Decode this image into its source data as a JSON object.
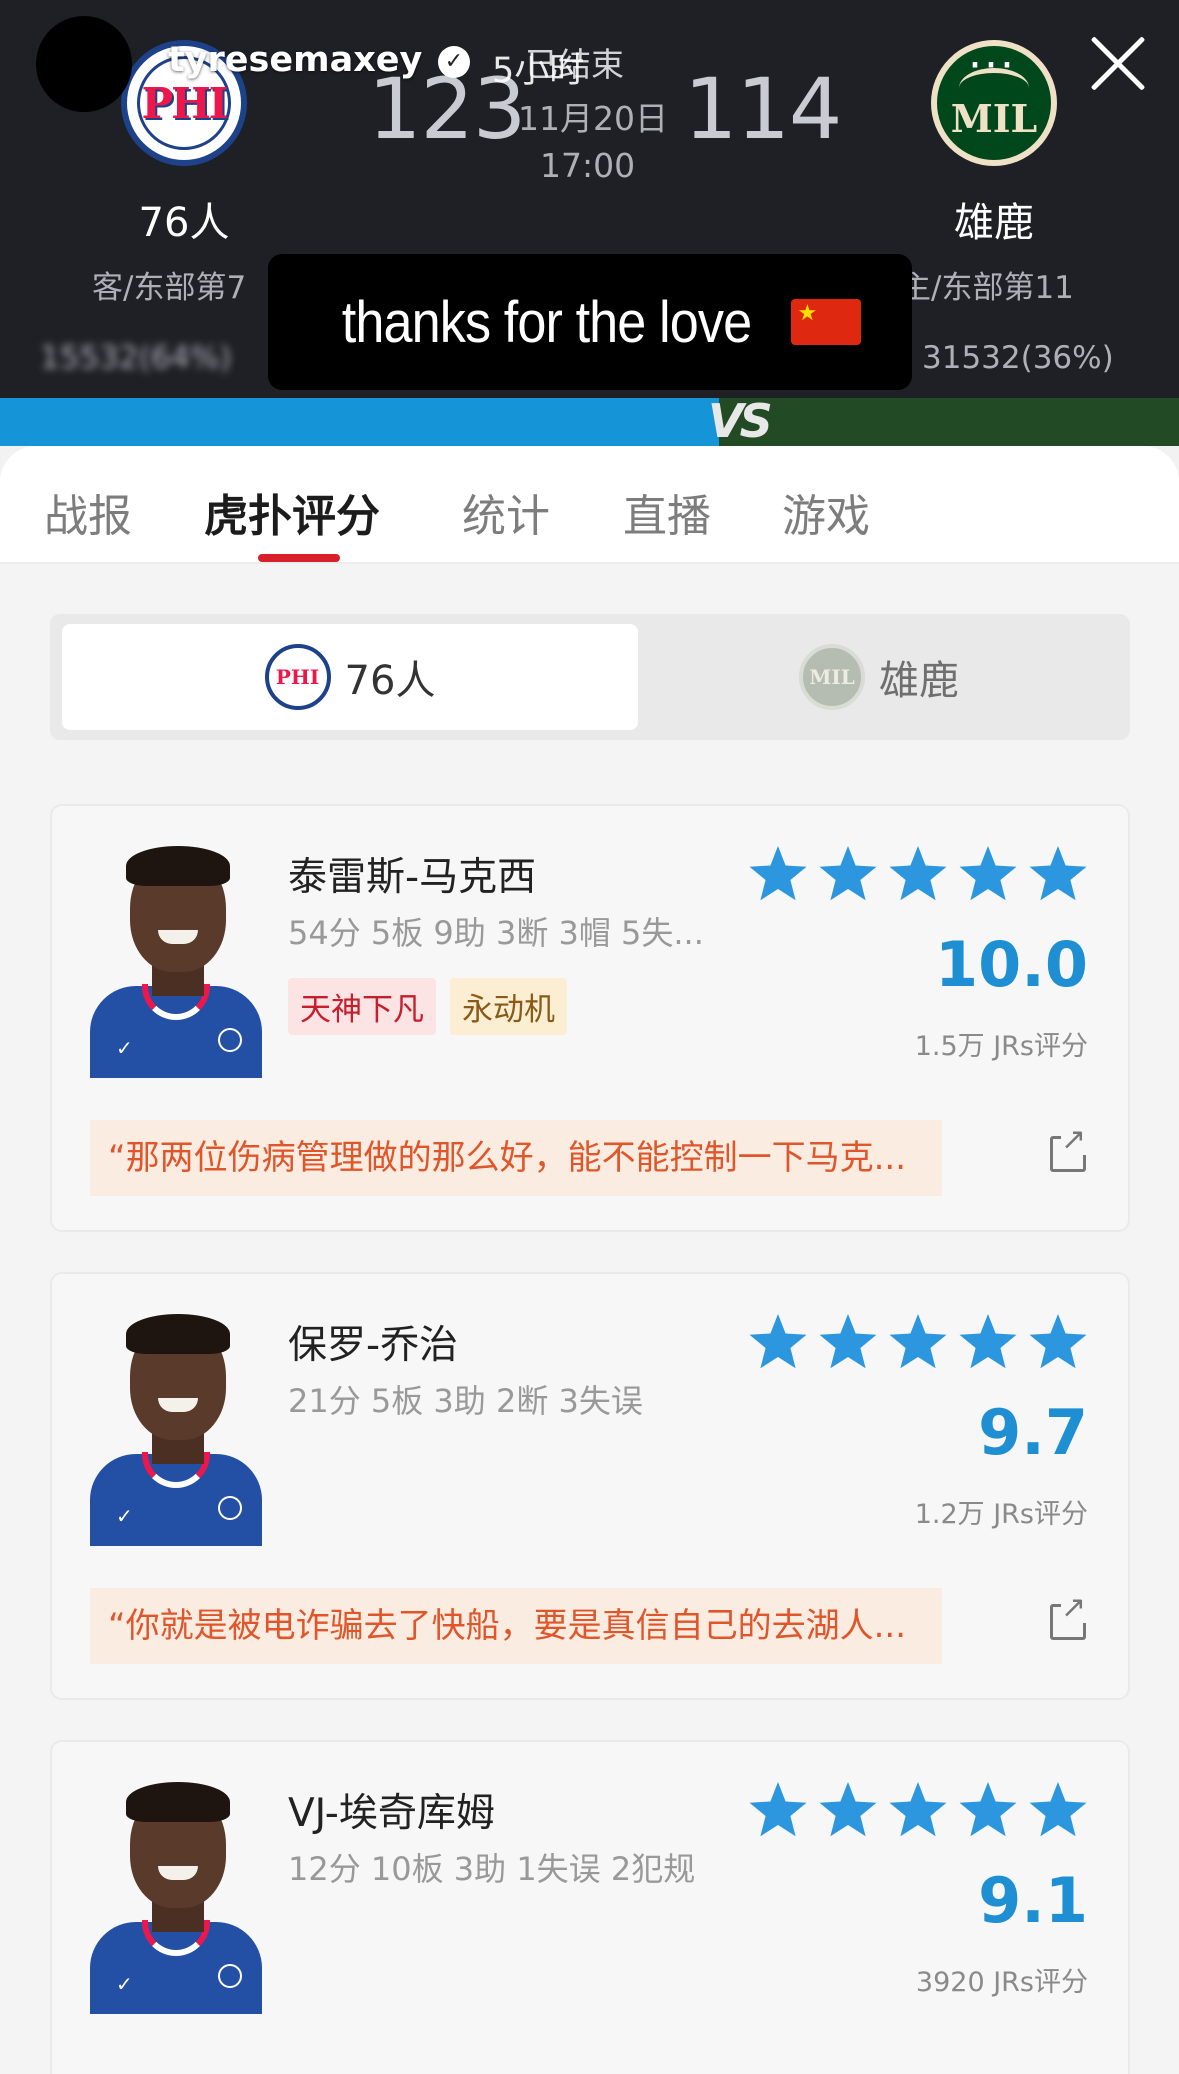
{
  "story": {
    "username": "tyresemaxey",
    "time": "5小时",
    "caption": "thanks for the love"
  },
  "game": {
    "status": "已结束",
    "date": "11月20日",
    "time": "17:00",
    "home": {
      "name": "76人",
      "logo_text": "PHI",
      "score": "123",
      "rank": "客/东部第7",
      "support": "15532(64%)"
    },
    "away": {
      "name": "雄鹿",
      "logo_text": "MIL",
      "score": "114",
      "rank": "主/东部第11",
      "support": "31532(36%)"
    },
    "vs": "VS"
  },
  "tabs": [
    "战报",
    "虎扑评分",
    "统计",
    "直播",
    "游戏"
  ],
  "active_tab": "虎扑评分",
  "team_switch": {
    "active": "76人",
    "inactive": "雄鹿"
  },
  "players": [
    {
      "name": "泰雷斯-马克西",
      "stats": "54分 5板 9助 3断 3帽 5失...",
      "tags": [
        "天神下凡",
        "永动机"
      ],
      "stars": 5,
      "rating": "10.0",
      "votes": "1.5万 JRs评分",
      "quote": "“那两位伤病管理做的那么好，能不能控制一下马克..."
    },
    {
      "name": "保罗-乔治",
      "stats": "21分 5板 3助 2断 3失误",
      "tags": [],
      "stars": 5,
      "rating": "9.7",
      "votes": "1.2万 JRs评分",
      "quote": "“你就是被电诈骗去了快船，要是真信自己的去湖人..."
    },
    {
      "name": "VJ-埃奇库姆",
      "stats": "12分 10板 3助 1失误 2犯规",
      "tags": [],
      "stars": 5,
      "rating": "9.1",
      "votes": "3920 JRs评分",
      "quote": ""
    }
  ],
  "colors": {
    "header_bg": "#1f2026",
    "accent_red": "#d7202a",
    "rating_blue": "#1f8fd3",
    "star_blue": "#2c97de",
    "quote_orange": "#e0562a"
  }
}
